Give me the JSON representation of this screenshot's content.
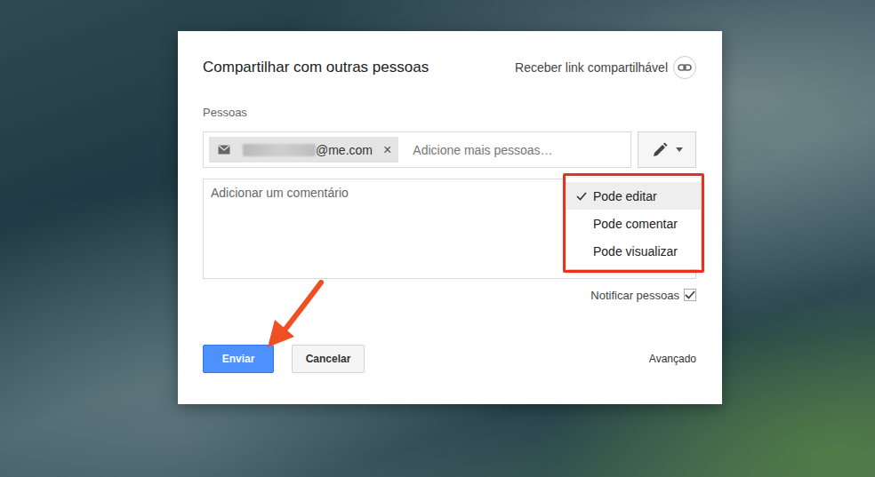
{
  "dialog": {
    "title": "Compartilhar com outras pessoas",
    "link_label": "Receber link compartilhável"
  },
  "people": {
    "label": "Pessoas",
    "chips": [
      {
        "text": "@me.com",
        "remove": "×"
      }
    ],
    "placeholder": "Adicione mais pessoas…"
  },
  "permission_menu": {
    "open": true,
    "items": [
      {
        "label": "Pode editar",
        "selected": true
      },
      {
        "label": "Pode comentar",
        "selected": false
      },
      {
        "label": "Pode visualizar",
        "selected": false
      }
    ]
  },
  "comment": {
    "placeholder": "Adicionar um comentário"
  },
  "notify": {
    "label": "Notificar pessoas",
    "checked": true
  },
  "buttons": [
    {
      "label": "Enviar",
      "kind": "primary"
    },
    {
      "label": "Cancelar",
      "kind": "secondary"
    }
  ],
  "advanced": "Avançado"
}
